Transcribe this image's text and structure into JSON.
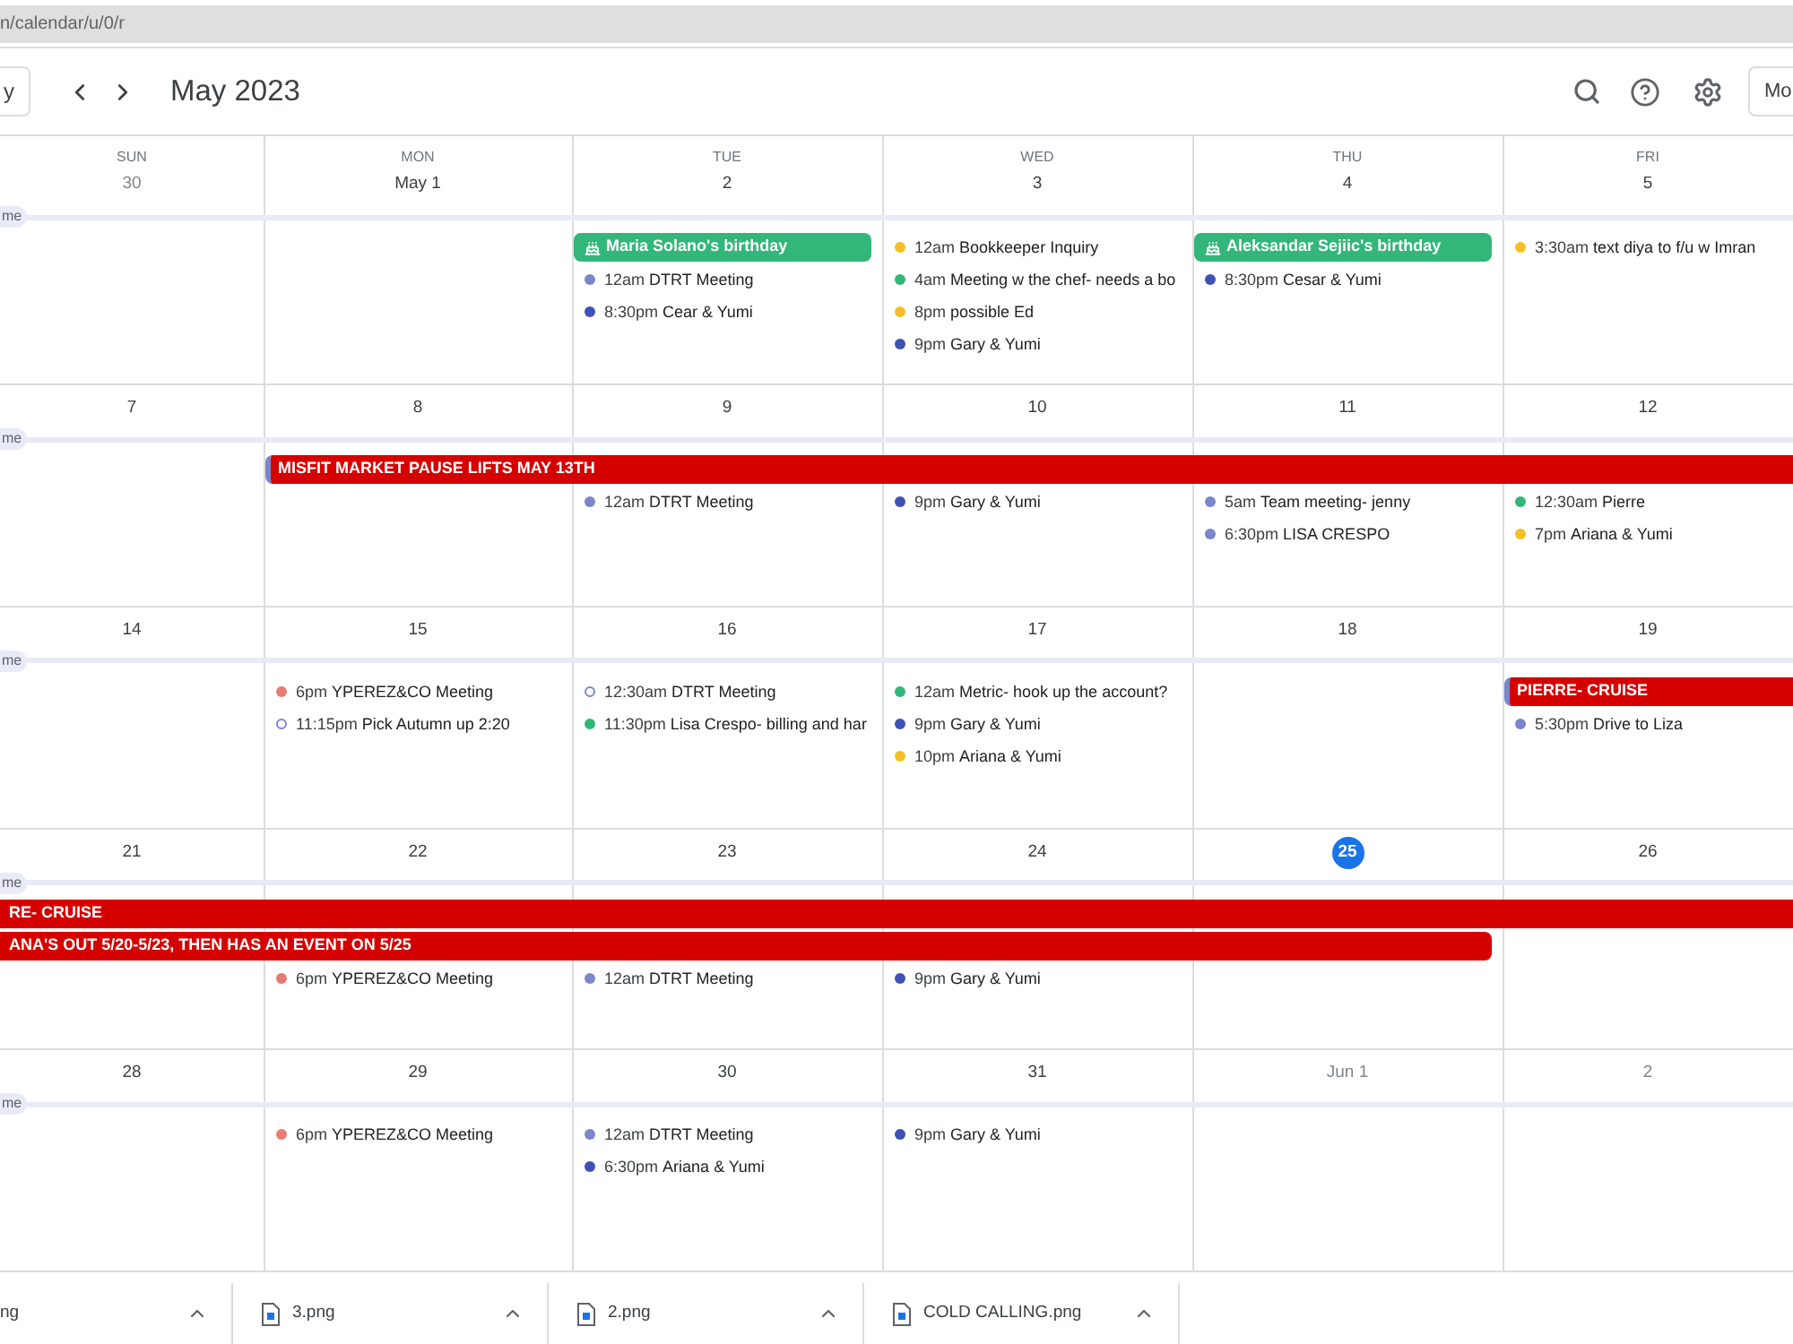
{
  "address_bar": {
    "value": "n/calendar/u/0/r"
  },
  "toolbar": {
    "today_button": "y",
    "title": "May 2023",
    "view_button": "Mo"
  },
  "weekdays": [
    "SUN",
    "MON",
    "TUE",
    "WED",
    "THU",
    "FRI"
  ],
  "weeks": [
    {
      "tag": "me",
      "days": [
        {
          "date": "30",
          "in_month": false,
          "today": false
        },
        {
          "date": "May 1",
          "in_month": true,
          "today": false
        },
        {
          "date": "2",
          "in_month": true,
          "today": false,
          "entries": [
            {
              "kind": "birthday",
              "title": "Maria Solano's birthday",
              "color": "#33b679",
              "stripe": false
            },
            {
              "kind": "event",
              "time": "12am",
              "title": "DTRT Meeting",
              "color": "#7986cb",
              "hollow": false
            },
            {
              "kind": "event",
              "time": "8:30pm",
              "title": "Cear & Yumi",
              "color": "#3f51b5",
              "hollow": false
            }
          ]
        },
        {
          "date": "3",
          "in_month": true,
          "today": false,
          "entries": [
            {
              "kind": "event",
              "time": "12am",
              "title": "Bookkeeper Inquiry",
              "color": "#f6bf26",
              "hollow": false
            },
            {
              "kind": "event",
              "time": "4am",
              "title": "Meeting w the chef- needs a bo",
              "color": "#33b679",
              "hollow": false
            },
            {
              "kind": "event",
              "time": "8pm",
              "title": "possible Ed",
              "color": "#f6bf26",
              "hollow": false
            },
            {
              "kind": "event",
              "time": "9pm",
              "title": "Gary & Yumi",
              "color": "#3f51b5",
              "hollow": false
            }
          ]
        },
        {
          "date": "4",
          "in_month": true,
          "today": false,
          "entries": [
            {
              "kind": "birthday",
              "title": "Aleksandar Sejiic's birthday",
              "color": "#33b679",
              "stripe": false
            },
            {
              "kind": "event",
              "time": "8:30pm",
              "title": "Cesar & Yumi",
              "color": "#3f51b5",
              "hollow": false
            }
          ]
        },
        {
          "date": "5",
          "in_month": true,
          "today": false,
          "entries": [
            {
              "kind": "event",
              "time": "3:30am",
              "title": "text diya to f/u w Imran",
              "color": "#f6bf26",
              "hollow": false
            }
          ]
        }
      ]
    },
    {
      "tag": "me",
      "days": [
        {
          "date": "7",
          "in_month": true,
          "today": false
        },
        {
          "date": "8",
          "in_month": true,
          "today": false,
          "entries": [
            {
              "kind": "allday",
              "title": "MISFIT MARKET PAUSE LIFTS MAY 13TH",
              "color": "#d50000",
              "stripe": true
            }
          ]
        },
        {
          "date": "9",
          "in_month": true,
          "today": false,
          "entries": [
            {
              "kind": "continued"
            },
            {
              "kind": "event",
              "time": "12am",
              "title": "DTRT Meeting",
              "color": "#7986cb",
              "hollow": false
            }
          ]
        },
        {
          "date": "10",
          "in_month": true,
          "today": false,
          "entries": [
            {
              "kind": "continued"
            },
            {
              "kind": "event",
              "time": "9pm",
              "title": "Gary & Yumi",
              "color": "#3f51b5",
              "hollow": false
            }
          ]
        },
        {
          "date": "11",
          "in_month": true,
          "today": false,
          "entries": [
            {
              "kind": "continued"
            },
            {
              "kind": "event",
              "time": "5am",
              "title": "Team meeting- jenny",
              "color": "#7986cb",
              "hollow": false
            },
            {
              "kind": "event",
              "time": "6:30pm",
              "title": "LISA CRESPO",
              "color": "#7986cb",
              "hollow": false
            }
          ]
        },
        {
          "date": "12",
          "in_month": true,
          "today": false,
          "entries": [
            {
              "kind": "continued"
            },
            {
              "kind": "event",
              "time": "12:30am",
              "title": "Pierre",
              "color": "#33b679",
              "hollow": false
            },
            {
              "kind": "event",
              "time": "7pm",
              "title": "Ariana & Yumi",
              "color": "#f6bf26",
              "hollow": false
            }
          ]
        }
      ]
    },
    {
      "tag": "me",
      "days": [
        {
          "date": "14",
          "in_month": true,
          "today": false
        },
        {
          "date": "15",
          "in_month": true,
          "today": false,
          "entries": [
            {
              "kind": "event",
              "time": "6pm",
              "title": "YPEREZ&CO Meeting",
              "color": "#e67c73",
              "hollow": false
            },
            {
              "kind": "event",
              "time": "11:15pm",
              "title": "Pick Autumn up 2:20",
              "color": "#7986cb",
              "hollow": true
            }
          ]
        },
        {
          "date": "16",
          "in_month": true,
          "today": false,
          "entries": [
            {
              "kind": "event",
              "time": "12:30am",
              "title": "DTRT Meeting",
              "color": "#7986cb",
              "hollow": true
            },
            {
              "kind": "event",
              "time": "11:30pm",
              "title": "Lisa Crespo- billing and har",
              "color": "#33b679",
              "hollow": false
            }
          ]
        },
        {
          "date": "17",
          "in_month": true,
          "today": false,
          "entries": [
            {
              "kind": "event",
              "time": "12am",
              "title": "Metric- hook up the account?",
              "color": "#33b679",
              "hollow": false
            },
            {
              "kind": "event",
              "time": "9pm",
              "title": "Gary & Yumi",
              "color": "#3f51b5",
              "hollow": false
            },
            {
              "kind": "event",
              "time": "10pm",
              "title": "Ariana & Yumi",
              "color": "#f6bf26",
              "hollow": false
            }
          ]
        },
        {
          "date": "18",
          "in_month": true,
          "today": false
        },
        {
          "date": "19",
          "in_month": true,
          "today": false,
          "entries": [
            {
              "kind": "allday",
              "title": "PIERRE- CRUISE",
              "color": "#d50000",
              "stripe": true
            },
            {
              "kind": "event",
              "time": "5:30pm",
              "title": "Drive to Liza",
              "color": "#7986cb",
              "hollow": false
            }
          ]
        }
      ]
    },
    {
      "tag": "me",
      "days": [
        {
          "date": "21",
          "in_month": true,
          "today": false,
          "entries": [
            {
              "kind": "allday",
              "title": "RE- CRUISE",
              "color": "#d50000",
              "stripe": false
            },
            {
              "kind": "allday",
              "title": "ANA'S OUT 5/20-5/23, THEN HAS AN EVENT ON 5/25",
              "color": "#d50000",
              "stripe": false
            }
          ]
        },
        {
          "date": "22",
          "in_month": true,
          "today": false,
          "entries": [
            {
              "kind": "continued"
            },
            {
              "kind": "continued"
            },
            {
              "kind": "event",
              "time": "6pm",
              "title": "YPEREZ&CO Meeting",
              "color": "#e67c73",
              "hollow": false
            }
          ]
        },
        {
          "date": "23",
          "in_month": true,
          "today": false,
          "entries": [
            {
              "kind": "continued"
            },
            {
              "kind": "continued"
            },
            {
              "kind": "event",
              "time": "12am",
              "title": "DTRT Meeting",
              "color": "#7986cb",
              "hollow": false
            }
          ]
        },
        {
          "date": "24",
          "in_month": true,
          "today": false,
          "entries": [
            {
              "kind": "continued"
            },
            {
              "kind": "continued"
            },
            {
              "kind": "event",
              "time": "9pm",
              "title": "Gary & Yumi",
              "color": "#3f51b5",
              "hollow": false
            }
          ]
        },
        {
          "date": "25",
          "in_month": true,
          "today": true,
          "entries": [
            {
              "kind": "continued"
            },
            {
              "kind": "continued"
            }
          ]
        },
        {
          "date": "26",
          "in_month": true,
          "today": false,
          "entries": [
            {
              "kind": "continued"
            }
          ]
        }
      ]
    },
    {
      "tag": "me",
      "days": [
        {
          "date": "28",
          "in_month": true,
          "today": false
        },
        {
          "date": "29",
          "in_month": true,
          "today": false,
          "entries": [
            {
              "kind": "event",
              "time": "6pm",
              "title": "YPEREZ&CO Meeting",
              "color": "#e67c73",
              "hollow": false
            }
          ]
        },
        {
          "date": "30",
          "in_month": true,
          "today": false,
          "entries": [
            {
              "kind": "event",
              "time": "12am",
              "title": "DTRT Meeting",
              "color": "#7986cb",
              "hollow": false
            },
            {
              "kind": "event",
              "time": "6:30pm",
              "title": "Ariana & Yumi",
              "color": "#3f51b5",
              "hollow": false
            }
          ]
        },
        {
          "date": "31",
          "in_month": true,
          "today": false,
          "entries": [
            {
              "kind": "event",
              "time": "9pm",
              "title": "Gary & Yumi",
              "color": "#3f51b5",
              "hollow": false
            }
          ]
        },
        {
          "date": "Jun 1",
          "in_month": false,
          "today": false
        },
        {
          "date": "2",
          "in_month": false,
          "today": false
        }
      ]
    }
  ],
  "downloads": [
    {
      "kind": "partial",
      "name": "ng"
    },
    {
      "kind": "file",
      "name": "3.png"
    },
    {
      "kind": "file",
      "name": "2.png"
    },
    {
      "kind": "file",
      "name": "COLD CALLING.png"
    }
  ]
}
